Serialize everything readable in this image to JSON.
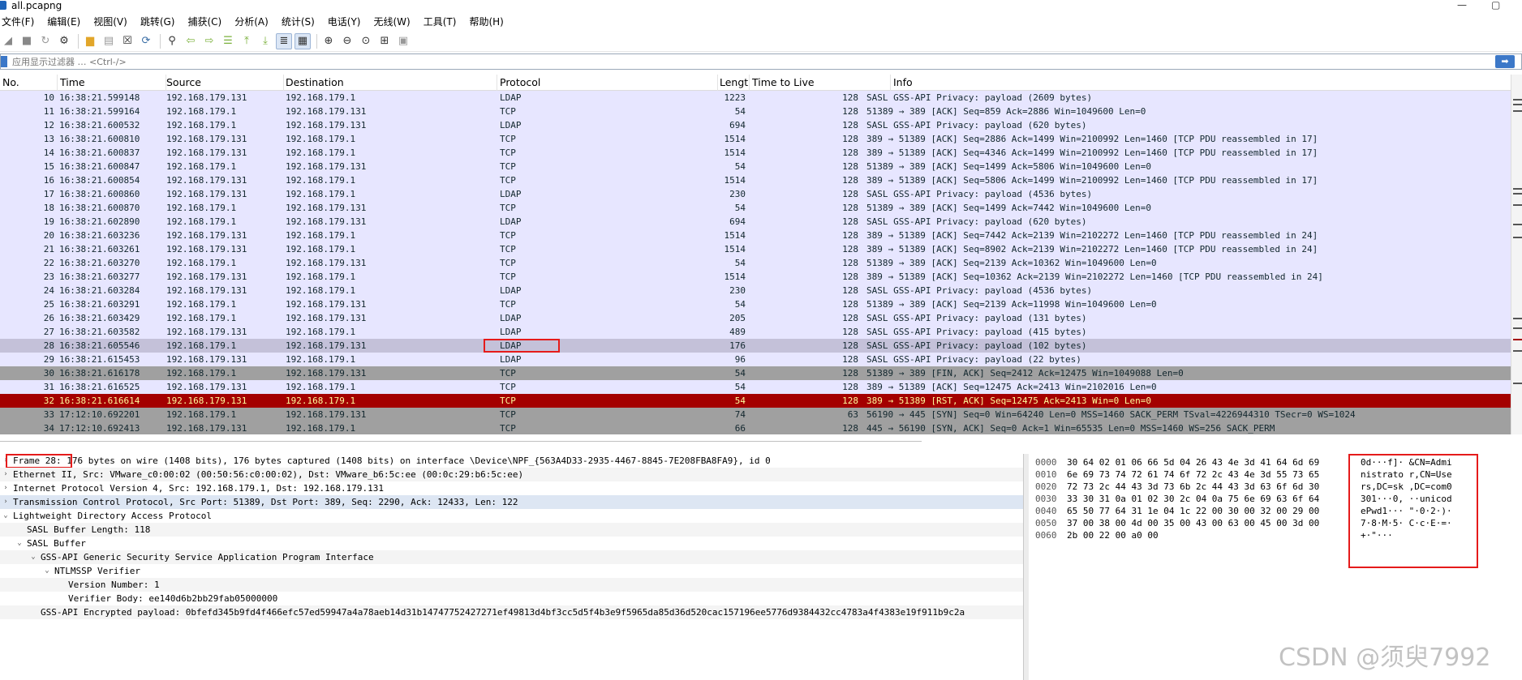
{
  "window": {
    "title": "all.pcapng",
    "minimize": "—",
    "maximize": "▢"
  },
  "menu": [
    "文件(F)",
    "编辑(E)",
    "视图(V)",
    "跳转(G)",
    "捕获(C)",
    "分析(A)",
    "统计(S)",
    "电话(Y)",
    "无线(W)",
    "工具(T)",
    "帮助(H)"
  ],
  "filter": {
    "placeholder": "应用显示过滤器 … <Ctrl-/>",
    "apply": "➡"
  },
  "columns": {
    "no": "No.",
    "time": "Time",
    "source": "Source",
    "destination": "Destination",
    "protocol": "Protocol",
    "length": "Lengt",
    "ttl": "Time to Live",
    "info": "Info"
  },
  "packets": [
    {
      "no": "10",
      "time": "16:38:21.599148",
      "src": "192.168.179.131",
      "dst": "192.168.179.1",
      "proto": "LDAP",
      "len": "1223",
      "ttl": "128",
      "info": "SASL GSS-API Privacy: payload (2609 bytes)",
      "style": ""
    },
    {
      "no": "11",
      "time": "16:38:21.599164",
      "src": "192.168.179.1",
      "dst": "192.168.179.131",
      "proto": "TCP",
      "len": "54",
      "ttl": "128",
      "info": "51389 → 389 [ACK] Seq=859 Ack=2886 Win=1049600 Len=0",
      "style": ""
    },
    {
      "no": "12",
      "time": "16:38:21.600532",
      "src": "192.168.179.1",
      "dst": "192.168.179.131",
      "proto": "LDAP",
      "len": "694",
      "ttl": "128",
      "info": "SASL GSS-API Privacy: payload (620 bytes)",
      "style": ""
    },
    {
      "no": "13",
      "time": "16:38:21.600810",
      "src": "192.168.179.131",
      "dst": "192.168.179.1",
      "proto": "TCP",
      "len": "1514",
      "ttl": "128",
      "info": "389 → 51389 [ACK] Seq=2886 Ack=1499 Win=2100992 Len=1460 [TCP PDU reassembled in 17]",
      "style": ""
    },
    {
      "no": "14",
      "time": "16:38:21.600837",
      "src": "192.168.179.131",
      "dst": "192.168.179.1",
      "proto": "TCP",
      "len": "1514",
      "ttl": "128",
      "info": "389 → 51389 [ACK] Seq=4346 Ack=1499 Win=2100992 Len=1460 [TCP PDU reassembled in 17]",
      "style": ""
    },
    {
      "no": "15",
      "time": "16:38:21.600847",
      "src": "192.168.179.1",
      "dst": "192.168.179.131",
      "proto": "TCP",
      "len": "54",
      "ttl": "128",
      "info": "51389 → 389 [ACK] Seq=1499 Ack=5806 Win=1049600 Len=0",
      "style": ""
    },
    {
      "no": "16",
      "time": "16:38:21.600854",
      "src": "192.168.179.131",
      "dst": "192.168.179.1",
      "proto": "TCP",
      "len": "1514",
      "ttl": "128",
      "info": "389 → 51389 [ACK] Seq=5806 Ack=1499 Win=2100992 Len=1460 [TCP PDU reassembled in 17]",
      "style": ""
    },
    {
      "no": "17",
      "time": "16:38:21.600860",
      "src": "192.168.179.131",
      "dst": "192.168.179.1",
      "proto": "LDAP",
      "len": "230",
      "ttl": "128",
      "info": "SASL GSS-API Privacy: payload (4536 bytes)",
      "style": ""
    },
    {
      "no": "18",
      "time": "16:38:21.600870",
      "src": "192.168.179.1",
      "dst": "192.168.179.131",
      "proto": "TCP",
      "len": "54",
      "ttl": "128",
      "info": "51389 → 389 [ACK] Seq=1499 Ack=7442 Win=1049600 Len=0",
      "style": ""
    },
    {
      "no": "19",
      "time": "16:38:21.602890",
      "src": "192.168.179.1",
      "dst": "192.168.179.131",
      "proto": "LDAP",
      "len": "694",
      "ttl": "128",
      "info": "SASL GSS-API Privacy: payload (620 bytes)",
      "style": ""
    },
    {
      "no": "20",
      "time": "16:38:21.603236",
      "src": "192.168.179.131",
      "dst": "192.168.179.1",
      "proto": "TCP",
      "len": "1514",
      "ttl": "128",
      "info": "389 → 51389 [ACK] Seq=7442 Ack=2139 Win=2102272 Len=1460 [TCP PDU reassembled in 24]",
      "style": ""
    },
    {
      "no": "21",
      "time": "16:38:21.603261",
      "src": "192.168.179.131",
      "dst": "192.168.179.1",
      "proto": "TCP",
      "len": "1514",
      "ttl": "128",
      "info": "389 → 51389 [ACK] Seq=8902 Ack=2139 Win=2102272 Len=1460 [TCP PDU reassembled in 24]",
      "style": ""
    },
    {
      "no": "22",
      "time": "16:38:21.603270",
      "src": "192.168.179.1",
      "dst": "192.168.179.131",
      "proto": "TCP",
      "len": "54",
      "ttl": "128",
      "info": "51389 → 389 [ACK] Seq=2139 Ack=10362 Win=1049600 Len=0",
      "style": ""
    },
    {
      "no": "23",
      "time": "16:38:21.603277",
      "src": "192.168.179.131",
      "dst": "192.168.179.1",
      "proto": "TCP",
      "len": "1514",
      "ttl": "128",
      "info": "389 → 51389 [ACK] Seq=10362 Ack=2139 Win=2102272 Len=1460 [TCP PDU reassembled in 24]",
      "style": ""
    },
    {
      "no": "24",
      "time": "16:38:21.603284",
      "src": "192.168.179.131",
      "dst": "192.168.179.1",
      "proto": "LDAP",
      "len": "230",
      "ttl": "128",
      "info": "SASL GSS-API Privacy: payload (4536 bytes)",
      "style": ""
    },
    {
      "no": "25",
      "time": "16:38:21.603291",
      "src": "192.168.179.1",
      "dst": "192.168.179.131",
      "proto": "TCP",
      "len": "54",
      "ttl": "128",
      "info": "51389 → 389 [ACK] Seq=2139 Ack=11998 Win=1049600 Len=0",
      "style": ""
    },
    {
      "no": "26",
      "time": "16:38:21.603429",
      "src": "192.168.179.1",
      "dst": "192.168.179.131",
      "proto": "LDAP",
      "len": "205",
      "ttl": "128",
      "info": "SASL GSS-API Privacy: payload (131 bytes)",
      "style": ""
    },
    {
      "no": "27",
      "time": "16:38:21.603582",
      "src": "192.168.179.131",
      "dst": "192.168.179.1",
      "proto": "LDAP",
      "len": "489",
      "ttl": "128",
      "info": "SASL GSS-API Privacy: payload (415 bytes)",
      "style": ""
    },
    {
      "no": "28",
      "time": "16:38:21.605546",
      "src": "192.168.179.1",
      "dst": "192.168.179.131",
      "proto": "LDAP",
      "len": "176",
      "ttl": "128",
      "info": "SASL GSS-API Privacy: payload (102 bytes)",
      "style": "selected"
    },
    {
      "no": "29",
      "time": "16:38:21.615453",
      "src": "192.168.179.131",
      "dst": "192.168.179.1",
      "proto": "LDAP",
      "len": "96",
      "ttl": "128",
      "info": "SASL GSS-API Privacy: payload (22 bytes)",
      "style": ""
    },
    {
      "no": "30",
      "time": "16:38:21.616178",
      "src": "192.168.179.1",
      "dst": "192.168.179.131",
      "proto": "TCP",
      "len": "54",
      "ttl": "128",
      "info": "51389 → 389 [FIN, ACK] Seq=2412 Ack=12475 Win=1049088 Len=0",
      "style": "tcp-flag"
    },
    {
      "no": "31",
      "time": "16:38:21.616525",
      "src": "192.168.179.131",
      "dst": "192.168.179.1",
      "proto": "TCP",
      "len": "54",
      "ttl": "128",
      "info": "389 → 51389 [ACK] Seq=12475 Ack=2413 Win=2102016 Len=0",
      "style": ""
    },
    {
      "no": "32",
      "time": "16:38:21.616614",
      "src": "192.168.179.131",
      "dst": "192.168.179.1",
      "proto": "TCP",
      "len": "54",
      "ttl": "128",
      "info": "389 → 51389 [RST, ACK] Seq=12475 Ack=2413 Win=0 Len=0",
      "style": "rst"
    },
    {
      "no": "33",
      "time": "17:12:10.692201",
      "src": "192.168.179.1",
      "dst": "192.168.179.131",
      "proto": "TCP",
      "len": "74",
      "ttl": "63",
      "info": "56190 → 445 [SYN] Seq=0 Win=64240 Len=0 MSS=1460 SACK_PERM TSval=4226944310 TSecr=0 WS=1024",
      "style": "tcp-flag"
    },
    {
      "no": "34",
      "time": "17:12:10.692413",
      "src": "192.168.179.131",
      "dst": "192.168.179.1",
      "proto": "TCP",
      "len": "66",
      "ttl": "128",
      "info": "445 → 56190 [SYN, ACK] Seq=0 Ack=1 Win=65535 Len=0 MSS=1460 WS=256 SACK_PERM",
      "style": "tcp-flag"
    }
  ],
  "details": [
    {
      "indent": 0,
      "arrow": "›",
      "text": "Frame 28: 176 bytes on wire (1408 bits), 176 bytes captured (1408 bits) on interface \\Device\\NPF_{563A4D33-2935-4467-8845-7E208FBA8FA9}, id 0",
      "style": ""
    },
    {
      "indent": 0,
      "arrow": "›",
      "text": "Ethernet II, Src: VMware_c0:00:02 (00:50:56:c0:00:02), Dst: VMware_b6:5c:ee (00:0c:29:b6:5c:ee)",
      "style": "alt"
    },
    {
      "indent": 0,
      "arrow": "›",
      "text": "Internet Protocol Version 4, Src: 192.168.179.1, Dst: 192.168.179.131",
      "style": ""
    },
    {
      "indent": 0,
      "arrow": "›",
      "text": "Transmission Control Protocol, Src Port: 51389, Dst Port: 389, Seq: 2290, Ack: 12433, Len: 122",
      "style": "hl"
    },
    {
      "indent": 0,
      "arrow": "⌄",
      "text": "Lightweight Directory Access Protocol",
      "style": ""
    },
    {
      "indent": 1,
      "arrow": "",
      "text": "SASL Buffer Length: 118",
      "style": "alt"
    },
    {
      "indent": 1,
      "arrow": "⌄",
      "text": "SASL Buffer",
      "style": ""
    },
    {
      "indent": 2,
      "arrow": "⌄",
      "text": "GSS-API Generic Security Service Application Program Interface",
      "style": "alt"
    },
    {
      "indent": 3,
      "arrow": "⌄",
      "text": "NTLMSSP Verifier",
      "style": ""
    },
    {
      "indent": 4,
      "arrow": "",
      "text": "Version Number: 1",
      "style": "alt"
    },
    {
      "indent": 4,
      "arrow": "",
      "text": "Verifier Body: ee140d6b2bb29fab05000000",
      "style": ""
    },
    {
      "indent": 2,
      "arrow": "",
      "text": "GSS-API Encrypted payload: 0bfefd345b9fd4f466efc57ed59947a4a78aeb14d31b14747752427271ef49813d4bf3cc5d5f4b3e9f5965da85d36d520cac157196ee5776d9384432cc4783a4f4383e19f911b9c2a",
      "style": "alt"
    }
  ],
  "bytes": [
    {
      "off": "0000",
      "hex": "30 64 02 01 06 66 5d 04   26 43 4e 3d 41 64 6d 69",
      "asc": "0d···f]· &CN=Admi"
    },
    {
      "off": "0010",
      "hex": "6e 69 73 74 72 61 74 6f   72 2c 43 4e 3d 55 73 65",
      "asc": "nistrato r,CN=Use"
    },
    {
      "off": "0020",
      "hex": "72 73 2c 44 43 3d 73 6b   2c 44 43 3d 63 6f 6d 30",
      "asc": "rs,DC=sk ,DC=com0"
    },
    {
      "off": "0030",
      "hex": "33 30 31 0a 01 02 30 2c   04 0a 75 6e 69 63 6f 64",
      "asc": "301···0, ··unicod"
    },
    {
      "off": "0040",
      "hex": "65 50 77 64 31 1e 04 1c   22 00 30 00 32 00 29 00",
      "asc": "ePwd1··· \"·0·2·)·"
    },
    {
      "off": "0050",
      "hex": "37 00 38 00 4d 00 35 00   43 00 63 00 45 00 3d 00",
      "asc": "7·8·M·5· C·c·E·=·"
    },
    {
      "off": "0060",
      "hex": "2b 00 22 00 a0 00",
      "asc": "+·\"···"
    }
  ],
  "watermark": "CSDN @须臾7992"
}
